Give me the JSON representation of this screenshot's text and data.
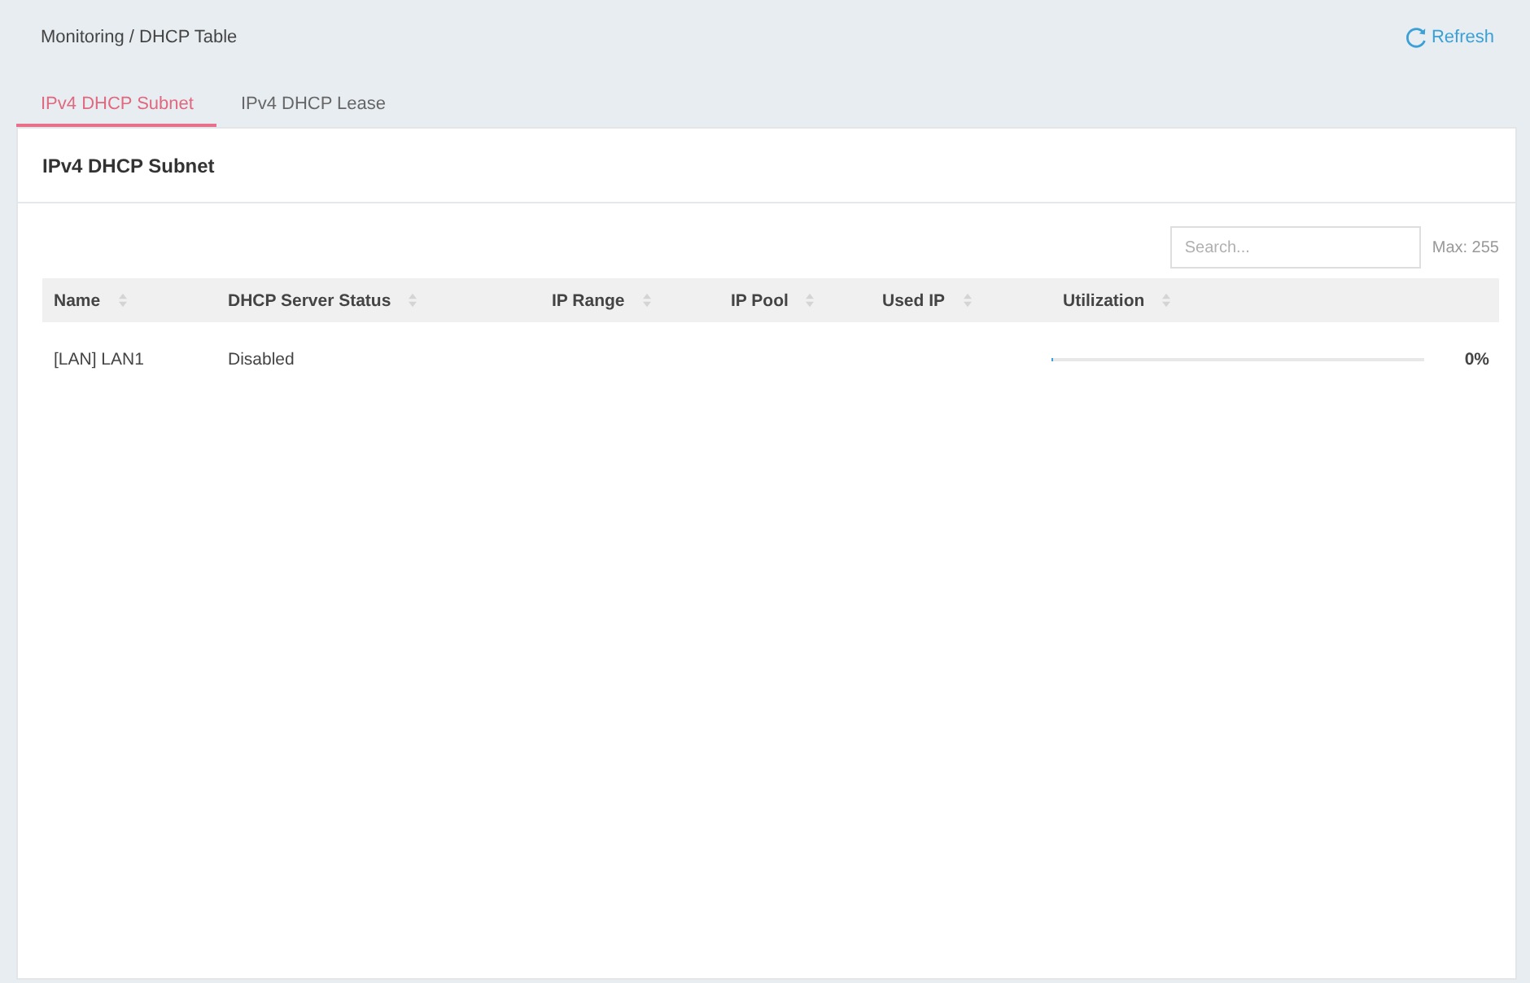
{
  "breadcrumb": "Monitoring / DHCP Table",
  "refresh": {
    "label": "Refresh"
  },
  "tabs": [
    {
      "label": "IPv4 DHCP Subnet",
      "selected": true
    },
    {
      "label": "IPv4 DHCP Lease",
      "selected": false
    }
  ],
  "panel": {
    "title": "IPv4 DHCP Subnet",
    "search": {
      "placeholder": "Search..."
    },
    "max_note": "Max: 255",
    "table": {
      "columns": [
        "Name",
        "DHCP Server Status",
        "IP Range",
        "IP Pool",
        "Used IP",
        "Utilization"
      ],
      "rows": [
        {
          "name": "[LAN] LAN1",
          "dhcp_server_status": "Disabled",
          "utilization": {
            "level": 0,
            "reading": "0%"
          }
        }
      ]
    }
  }
}
